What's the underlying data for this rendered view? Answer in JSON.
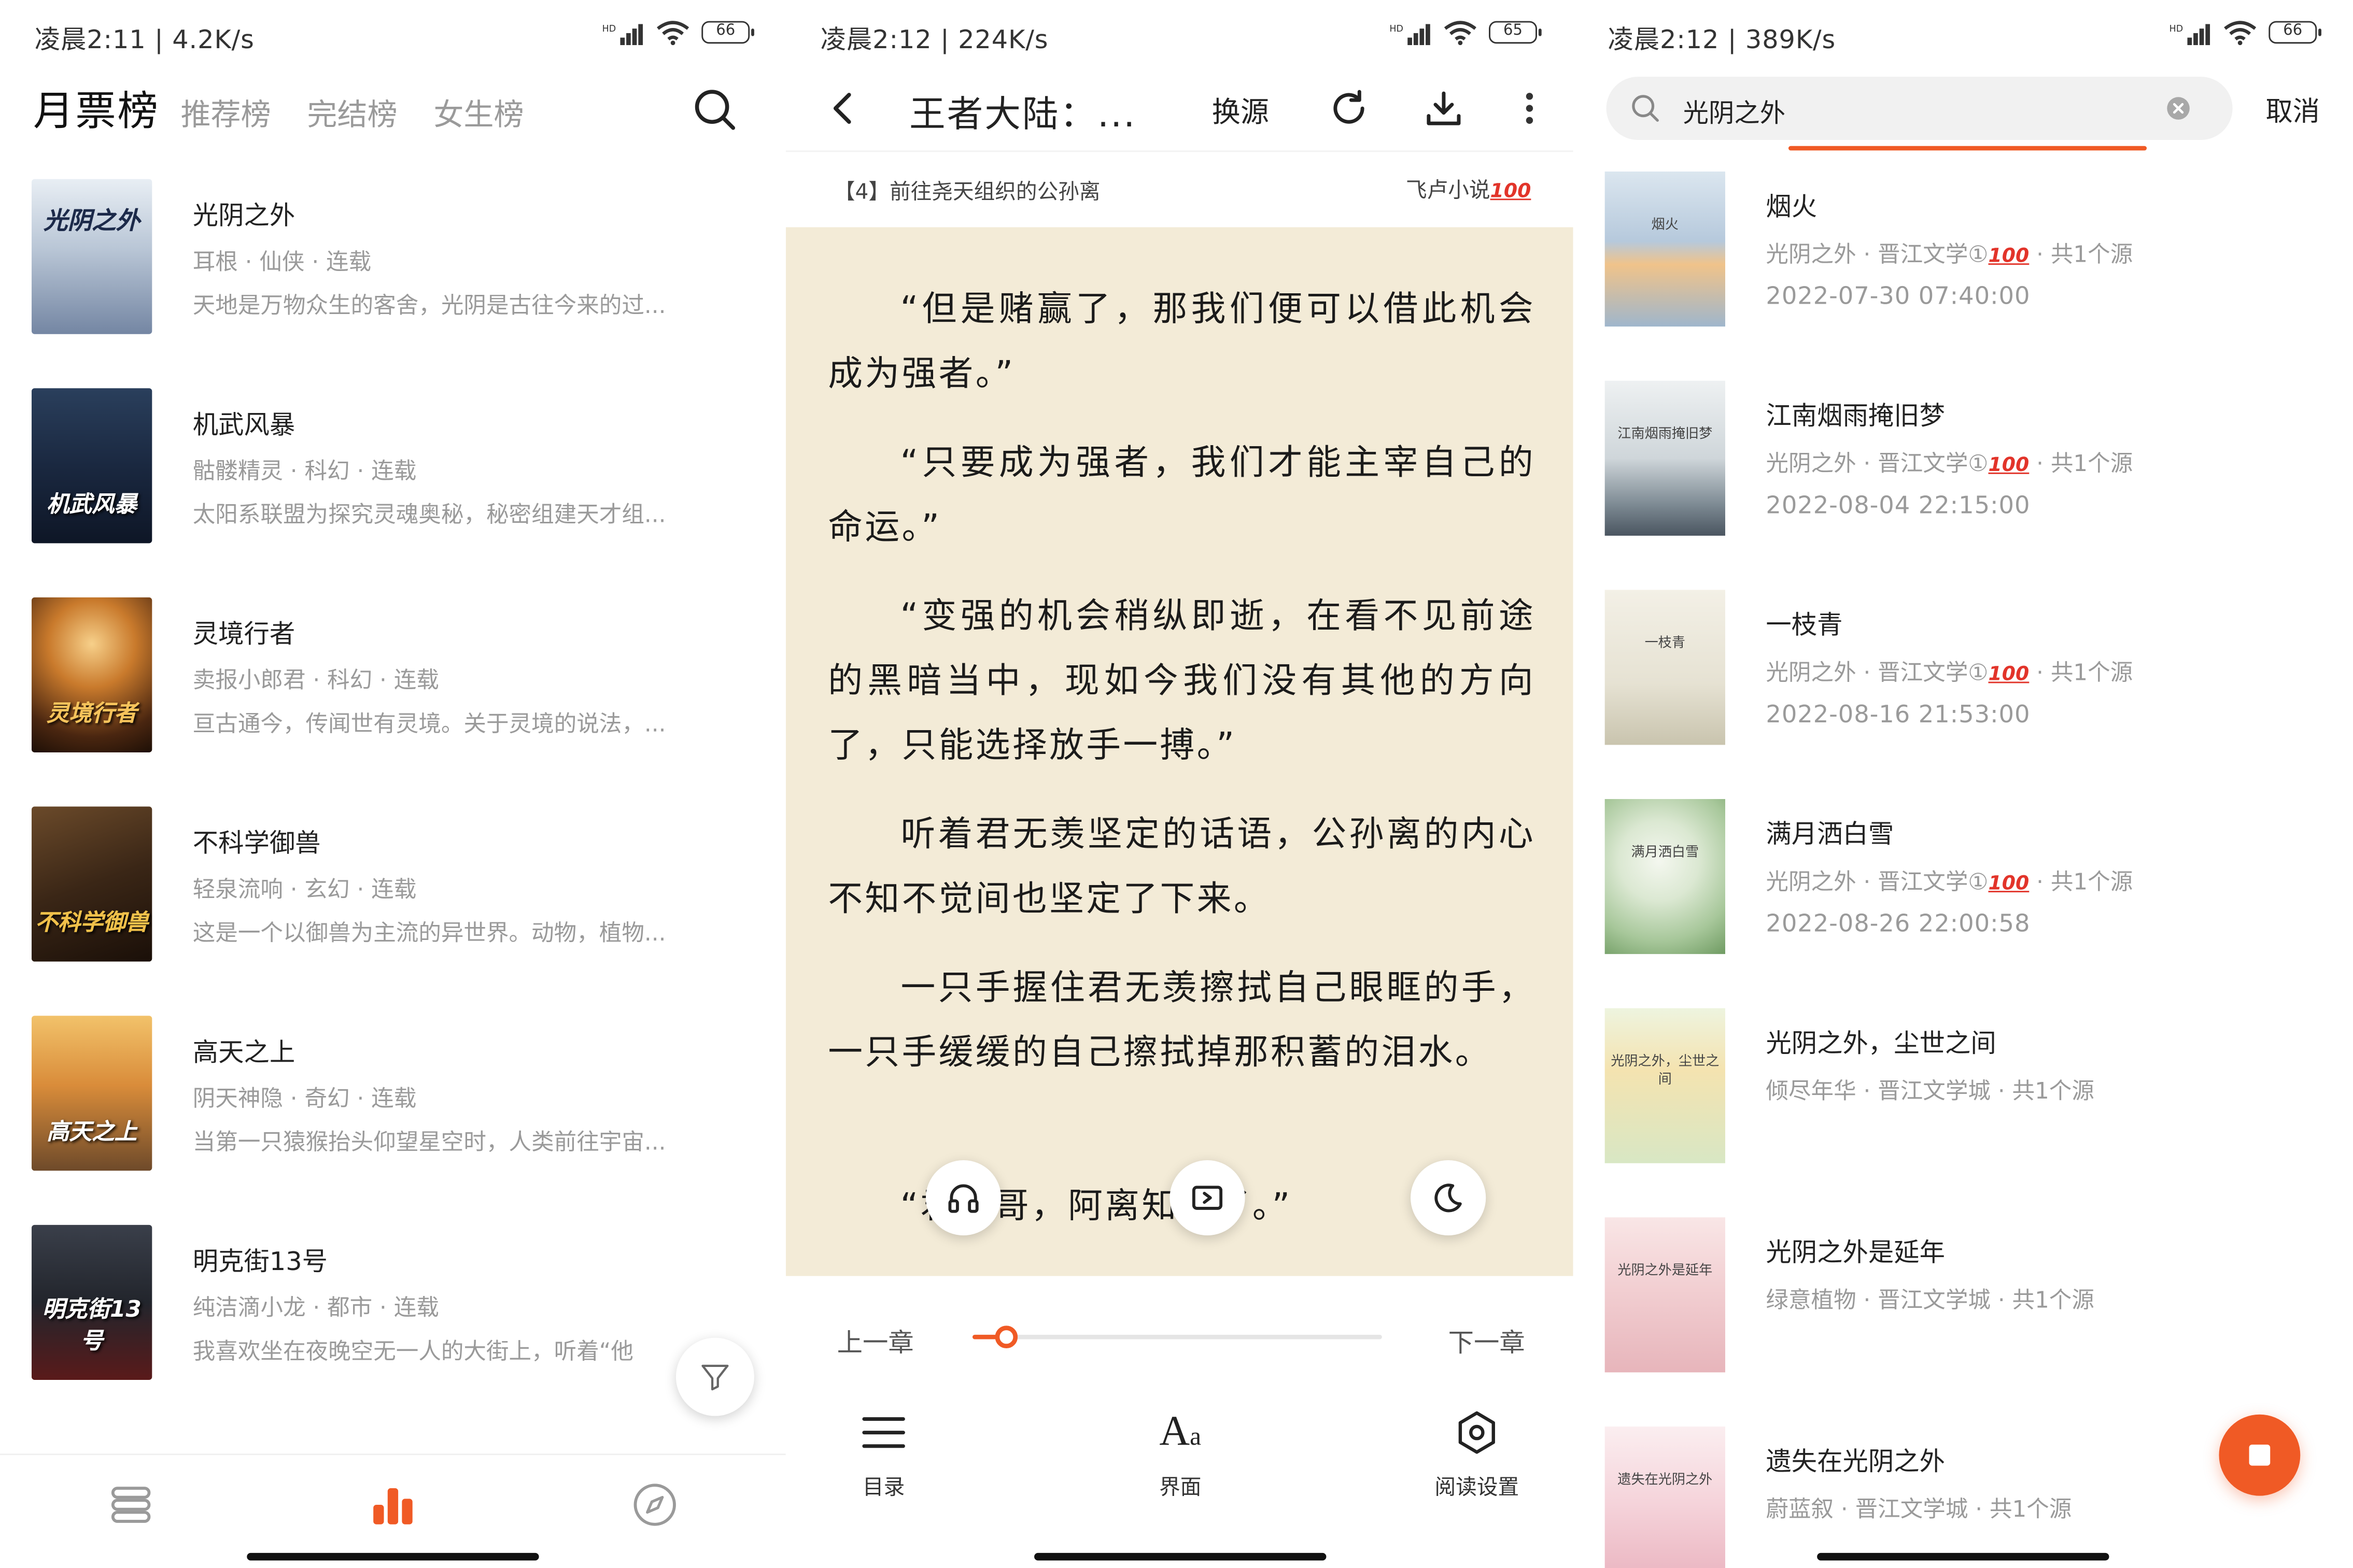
{
  "colors": {
    "accent": "#f05a25",
    "reading_bg": "#f3ebd7"
  },
  "panel1": {
    "status": {
      "time": "凌晨2:11 | 4.2K/s",
      "battery": "66"
    },
    "tabs": {
      "active": "月票榜",
      "t1": "推荐榜",
      "t2": "完结榜",
      "t3": "女生榜"
    },
    "books": [
      {
        "title": "光阴之外",
        "meta": "耳根 · 仙侠 · 连载",
        "desc": "天地是万物众生的客舍，光阴是古往今来的过...",
        "cover_text": "光阴之外"
      },
      {
        "title": "机武风暴",
        "meta": "骷髅精灵 · 科幻 · 连载",
        "desc": "太阳系联盟为探究灵魂奥秘，秘密组建天才组...",
        "cover_text": "机武风暴"
      },
      {
        "title": "灵境行者",
        "meta": "卖报小郎君 · 科幻 · 连载",
        "desc": "亘古通今，传闻世有灵境。关于灵境的说法，...",
        "cover_text": "灵境行者"
      },
      {
        "title": "不科学御兽",
        "meta": "轻泉流响 · 玄幻 · 连载",
        "desc": "这是一个以御兽为主流的异世界。动物，植物...",
        "cover_text": "不科学御兽"
      },
      {
        "title": "高天之上",
        "meta": "阴天神隐 · 奇幻 · 连载",
        "desc": "当第一只猿猴抬头仰望星空时，人类前往宇宙...",
        "cover_text": "高天之上"
      },
      {
        "title": "明克街13号",
        "meta": "纯洁滴小龙 · 都市 · 连载",
        "desc": "我喜欢坐在夜晚空无一人的大街上，听着“他",
        "cover_text": "明克街13号"
      }
    ]
  },
  "panel2": {
    "status": {
      "time": "凌晨2:12 | 224K/s",
      "battery": "65"
    },
    "title": "王者大陆：...",
    "source_btn": "换源",
    "chapter": "【4】前往尧天组织的公孙离",
    "source_name": "飞卢小说",
    "source_badge": "100",
    "paragraphs": [
      "“但是赌赢了，那我们便可以借此机会成为强者。”",
      "“只要成为强者，我们才能主宰自己的命运。”",
      "“变强的机会稍纵即逝，在看不见前途的黑暗当中，现如今我们没有其他的方向了，只能选择放手一搏。”",
      "听着君无羡坚定的话语，公孙离的内心不知不觉间也坚定了下来。",
      "一只手握住君无羡擦拭自己眼眶的手，一只手缓缓的自己擦拭掉那积蓄的泪水。",
      "“君哥哥，阿离知道了。”"
    ],
    "prev_chapter": "上一章",
    "next_chapter": "下一章",
    "progress": 0.08,
    "menu": {
      "toc": "目录",
      "ui": "界面",
      "settings": "阅读设置"
    },
    "aa_big": "A",
    "aa_small": "a"
  },
  "panel3": {
    "status": {
      "time": "凌晨2:12 | 389K/s",
      "battery": "66"
    },
    "search_value": "光阴之外",
    "cancel": "取消",
    "badge": "100",
    "results": [
      {
        "title": "烟火",
        "meta_a": "光阴之外 · 晋江文学①",
        "meta_b": " · 共1个源",
        "date": "2022-07-30 07:40:00",
        "cover_text": "烟火"
      },
      {
        "title": "江南烟雨掩旧梦",
        "meta_a": "光阴之外 · 晋江文学①",
        "meta_b": " · 共1个源",
        "date": "2022-08-04 22:15:00",
        "cover_text": "江南烟雨掩旧梦"
      },
      {
        "title": "一枝青",
        "meta_a": "光阴之外 · 晋江文学①",
        "meta_b": " · 共1个源",
        "date": "2022-08-16 21:53:00",
        "cover_text": "一枝青"
      },
      {
        "title": "满月洒白雪",
        "meta_a": "光阴之外 · 晋江文学①",
        "meta_b": " · 共1个源",
        "date": "2022-08-26 22:00:58",
        "cover_text": "满月洒白雪"
      },
      {
        "title": "光阴之外，尘世之间",
        "meta_a": "倾尽年华 · 晋江文学城 · 共1个源",
        "meta_b": "",
        "date": "",
        "cover_text": "光阴之外，尘世之间"
      },
      {
        "title": "光阴之外是延年",
        "meta_a": "绿意植物 · 晋江文学城 · 共1个源",
        "meta_b": "",
        "date": "",
        "cover_text": "光阴之外是延年"
      },
      {
        "title": "遗失在光阴之外",
        "meta_a": "蔚蓝叙 · 晋江文学城 · 共1个源",
        "meta_b": "",
        "date": "",
        "cover_text": "遗失在光阴之外"
      }
    ]
  }
}
